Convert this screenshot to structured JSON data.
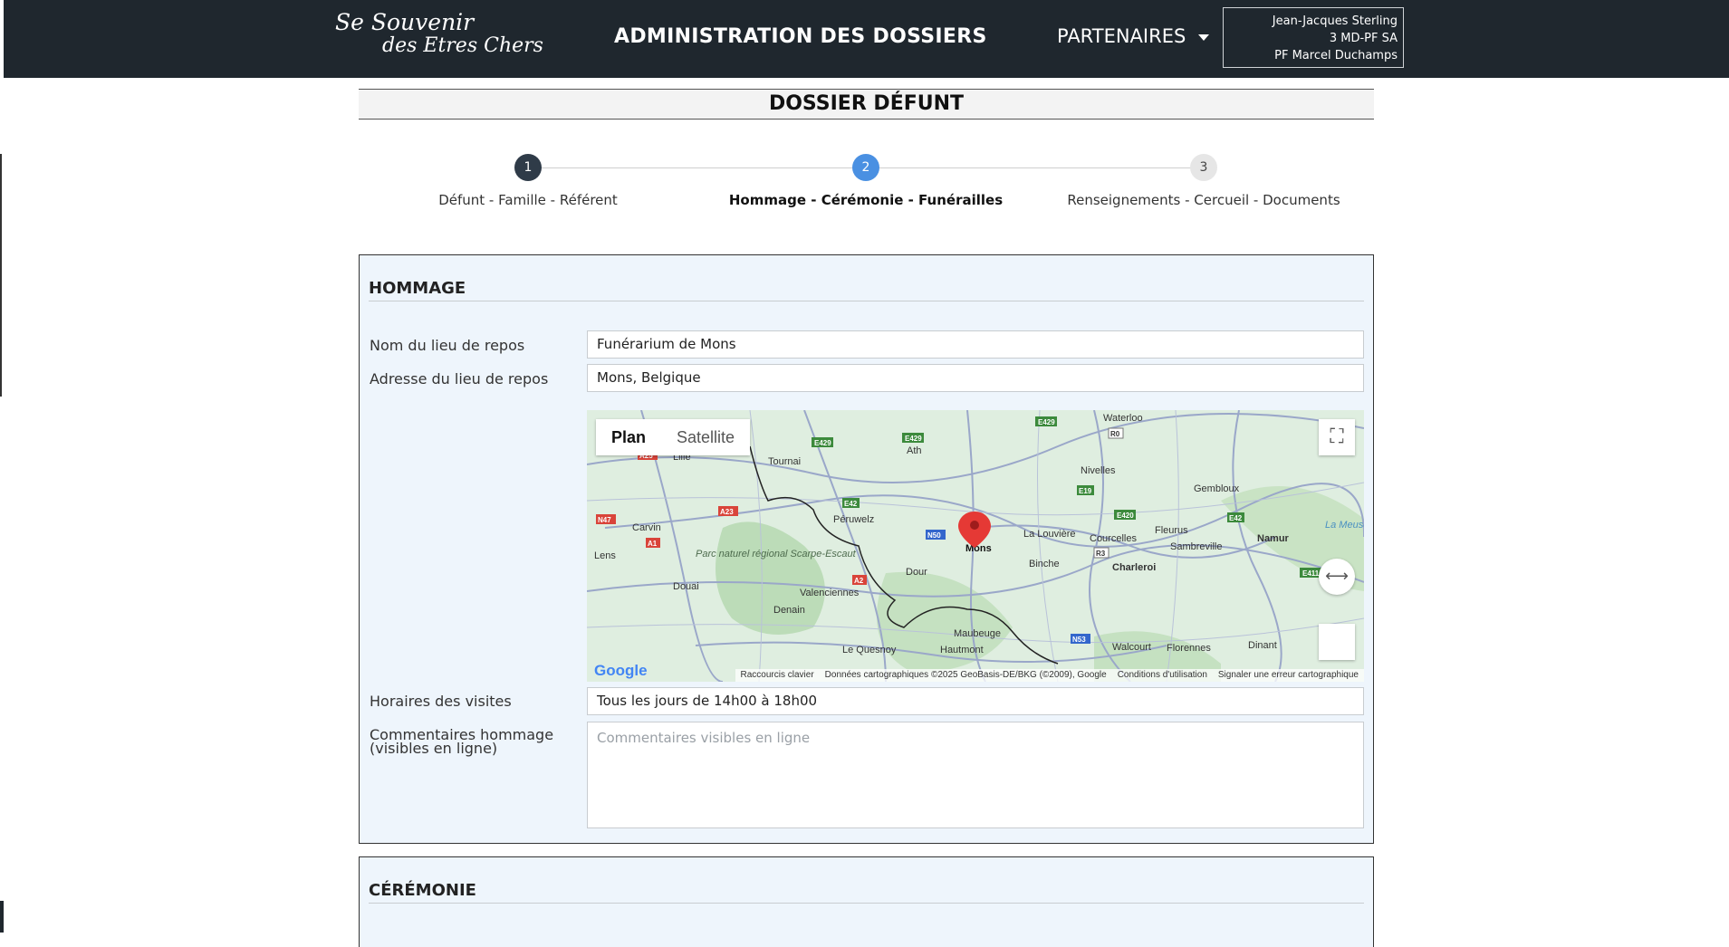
{
  "header": {
    "logo_line1": "Se Souvenir",
    "logo_line2": "des Etres Chers",
    "title": "ADMINISTRATION DES DOSSIERS",
    "partners_label": "PARTENAIRES",
    "user": {
      "name": "Jean-Jacques Sterling",
      "company": "3 MD-PF SA",
      "agency": "PF Marcel Duchamps"
    }
  },
  "page_title": "DOSSIER DÉFUNT",
  "steps": [
    {
      "number": "1",
      "label": "Défunt - Famille - Référent",
      "state": "done"
    },
    {
      "number": "2",
      "label": "Hommage - Cérémonie - Funérailles",
      "state": "active"
    },
    {
      "number": "3",
      "label": "Renseignements - Cercueil - Documents",
      "state": "todo"
    }
  ],
  "hommage": {
    "title": "HOMMAGE",
    "rest_place_name_label": "Nom du lieu de repos",
    "rest_place_name_value": "Funérarium de Mons",
    "rest_place_address_label": "Adresse du lieu de repos",
    "rest_place_address_value": "Mons, Belgique",
    "visits_label": "Horaires des visites",
    "visits_value": "Tous les jours de 14h00 à 18h00",
    "comments_label": "Commentaires hommage (visibles en ligne)",
    "comments_placeholder": "Commentaires visibles en ligne"
  },
  "map": {
    "type_plan": "Plan",
    "type_satellite": "Satellite",
    "marker_city": "Mons",
    "places": [
      "Waterloo",
      "Nivelles",
      "Gembloux",
      "Ath",
      "Tournai",
      "Lille",
      "Péruwelz",
      "La Louvière",
      "Courcelles",
      "Fleurus",
      "Sambreville",
      "Namur",
      "Charleroi",
      "Binche",
      "Carvin",
      "Lens",
      "Douai",
      "Valenciennes",
      "Dour",
      "Denain",
      "Maubeuge",
      "Hautmont",
      "Le Quesnoy",
      "Walcourt",
      "Florennes",
      "Dinant",
      "Parc naturel régional Scarpe-Escaut",
      "La Meuse"
    ],
    "roads": [
      "E429",
      "E429",
      "E429",
      "E19",
      "E42",
      "E420",
      "E42",
      "E411",
      "A23",
      "A1",
      "N47",
      "A2",
      "N50",
      "N53",
      "R3",
      "R0",
      "A25"
    ],
    "attribution": [
      "Raccourcis clavier",
      "Données cartographiques ©2025 GeoBasis-DE/BKG (©2009), Google",
      "Conditions d'utilisation",
      "Signaler une erreur cartographique"
    ],
    "google_logo": "Google",
    "colors": {
      "land": "#dfeee0",
      "forest": "#bcdcb8",
      "roads": "#9aa7c9",
      "border": "#222222",
      "marker": "#e53935"
    }
  },
  "ceremonie": {
    "title": "CÉRÉMONIE"
  },
  "colors": {
    "topbar": "#1f272e",
    "section_bg": "#eef5fc",
    "step_done": "#2f3b48",
    "step_active": "#4a90e2",
    "step_todo": "#e6e6e6"
  }
}
